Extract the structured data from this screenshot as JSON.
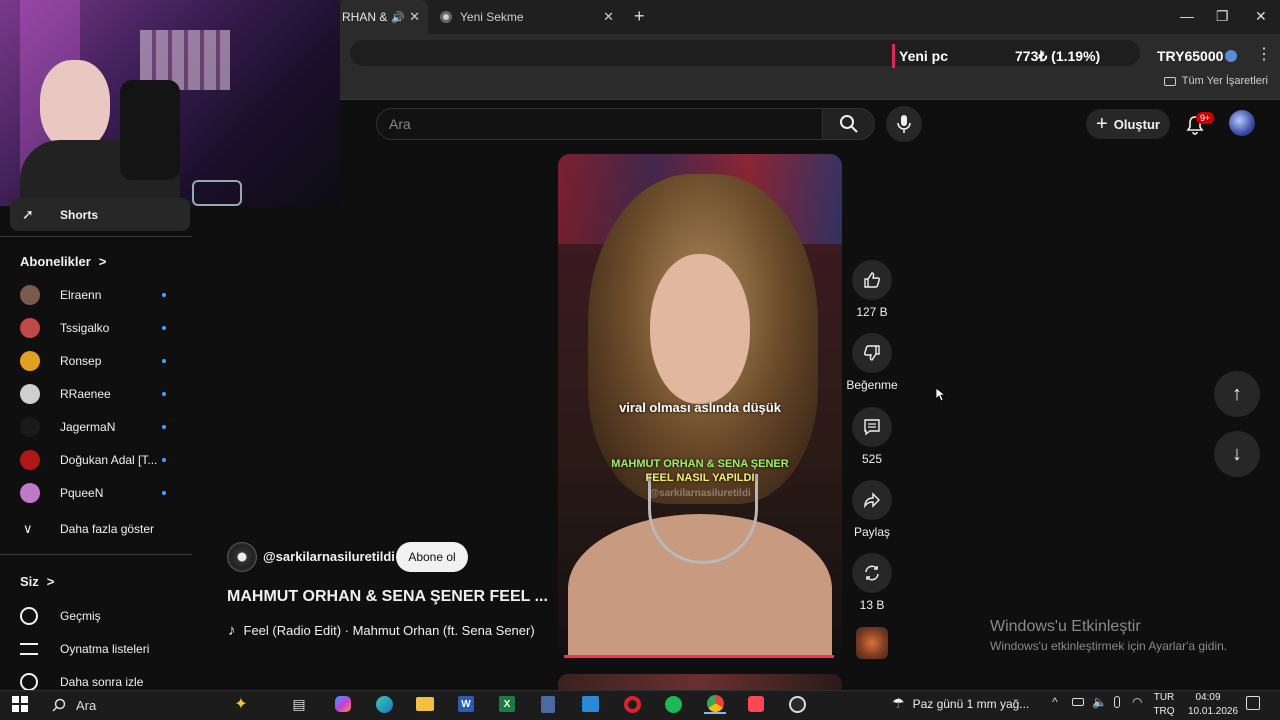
{
  "browser": {
    "tabs": [
      {
        "label": "RHAN & "
      },
      {
        "label": "Yeni Sekme"
      }
    ],
    "new_tab_symbol": "+",
    "window_controls": {
      "minimize": "—",
      "maximize": "❐",
      "close": "✕"
    },
    "ticker": {
      "label": "Yeni pc",
      "value": "773₺ (1.19%)",
      "goal": "TRY65000"
    },
    "bookmarks_label": "Tüm Yer İşaretleri"
  },
  "header": {
    "search_placeholder": "Ara",
    "create_label": "Oluştur",
    "notification_badge": "9+"
  },
  "sidebar": {
    "shorts_label": "Shorts",
    "subscriptions_label": "Abonelikler",
    "subscriptions_chevron": ">",
    "subscriptions": [
      {
        "name": "Elraenn",
        "color": "#7a5a4a"
      },
      {
        "name": "Tssigalko",
        "color": "#c04848"
      },
      {
        "name": "Ronsep",
        "color": "#e0a020"
      },
      {
        "name": "RRaenee",
        "color": "#cfcfcf"
      },
      {
        "name": "JagermaN",
        "color": "#1a1a1a"
      },
      {
        "name": "Doğukan Adal [T...",
        "color": "#b01818"
      },
      {
        "name": "PqueeN",
        "color": "#c078c8"
      }
    ],
    "show_more_label": "Daha fazla göster",
    "you_label": "Siz",
    "you_chevron": ">",
    "you_items": [
      {
        "name": "Geçmiş",
        "icon": "history-icon"
      },
      {
        "name": "Oynatma listeleri",
        "icon": "playlist-icon"
      },
      {
        "name": "Daha sonra izle",
        "icon": "watch-later-icon"
      }
    ]
  },
  "short": {
    "caption_line": "viral olması aslında düşük",
    "overlay_line1": "MAHMUT ORHAN & SENA ŞENER",
    "overlay_line2": "FEEL NASIL YAPILDI",
    "overlay_watermark": "@sarkilarnasiluretildi",
    "channel": "@sarkilarnasiluretildi",
    "subscribe_label": "Abone ol",
    "title": "MAHMUT ORHAN & SENA ŞENER FEEL ...",
    "music": "Feel (Radio Edit) · Mahmut Orhan (ft. Sena Sener)",
    "likes": "127 B",
    "dislike_label": "Beğenme",
    "comments": "525",
    "share_label": "Paylaş",
    "remix": "13 B"
  },
  "windows_watermark": {
    "title": "Windows'u Etkinleştir",
    "subtitle": "Windows'u etkinleştirmek için Ayarlar'a gidin."
  },
  "taskbar": {
    "search_label": "Ara",
    "weather": "Paz günü 1 mm yağ...",
    "lang_line1": "TUR",
    "lang_line2": "TRQ",
    "time": "04:09",
    "date": "10.01.2026"
  },
  "colors": {
    "accent_red": "#ff0000",
    "link_blue": "#3ea6ff",
    "progress": "#ff2d55"
  }
}
